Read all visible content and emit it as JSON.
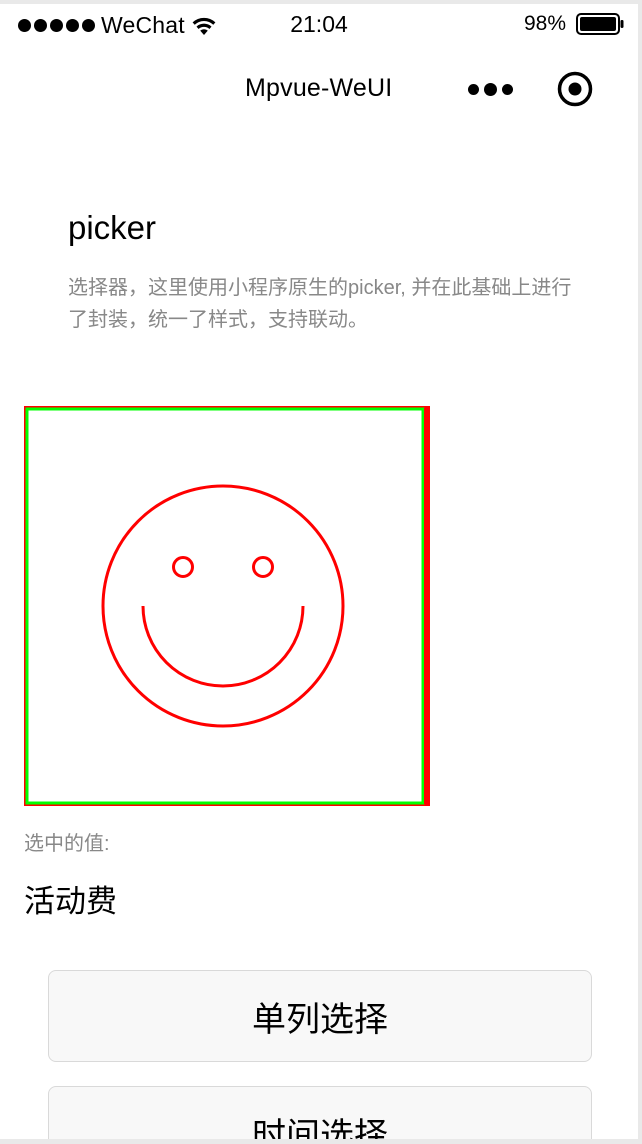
{
  "statusbar": {
    "carrier": "WeChat",
    "time": "21:04",
    "battery": "98%"
  },
  "navbar": {
    "title": "Mpvue-WeUI",
    "more_icon": "more-dots-icon",
    "record_icon": "record-icon"
  },
  "page": {
    "title": "picker",
    "description": "选择器，这里使用小程序原生的picker, 并在此基础上进行了封装，统一了样式，支持联动。"
  },
  "picker_image": {
    "icon": "smiley-face-icon",
    "stroke_color": "#ff0000",
    "frame_color": "#00ff00"
  },
  "selection": {
    "label": "选中的值:",
    "value": "活动费"
  },
  "buttons": {
    "single": "单列选择",
    "time": "时间选择"
  },
  "colors": {
    "text_secondary": "#888888",
    "button_bg": "#f8f8f8",
    "button_border": "#d9d9d9"
  }
}
